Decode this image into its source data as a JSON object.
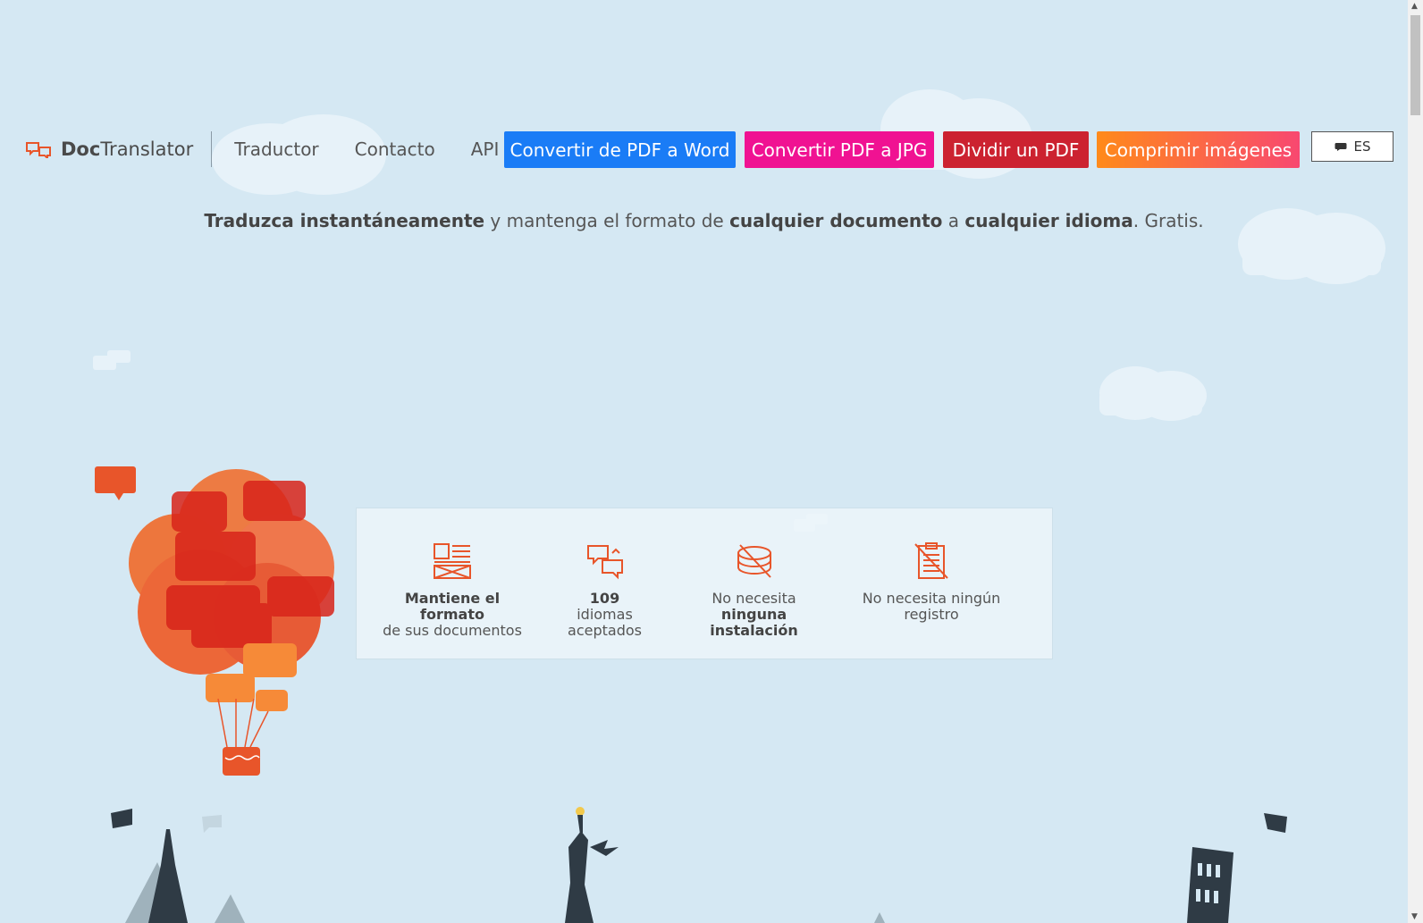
{
  "brand": {
    "bold": "Doc",
    "rest": "Translator"
  },
  "nav": {
    "items": [
      {
        "label": "Traductor"
      },
      {
        "label": "Contacto"
      },
      {
        "label": "API"
      }
    ]
  },
  "tools": {
    "pdf_to_word": "Convertir de PDF a Word",
    "pdf_to_jpg": "Convertir PDF a JPG",
    "split_pdf": "Dividir un PDF",
    "compress_images": "Comprimir imágenes"
  },
  "language": {
    "code": "ES"
  },
  "tagline": {
    "part1": "Traduzca instantáneamente",
    "part2": " y mantenga el formato de ",
    "part3": "cualquier documento",
    "part4": " a ",
    "part5": "cualquier idioma",
    "part6": ". Gratis."
  },
  "features": [
    {
      "line1": "Mantiene el formato",
      "line2": "de sus documentos"
    },
    {
      "line1": "109",
      "line2": "idiomas aceptados"
    },
    {
      "line1": "No necesita",
      "line2": "ninguna instalación"
    },
    {
      "line1": "No necesita ningún registro"
    }
  ],
  "colors": {
    "background": "#d5e8f3",
    "pdf_to_word": "#1a7cf6",
    "pdf_to_jpg": "#f01292",
    "split_pdf": "#cc2230",
    "compress_start": "#ff8a1a",
    "compress_end": "#f84870",
    "accent_orange": "#e8552a"
  }
}
